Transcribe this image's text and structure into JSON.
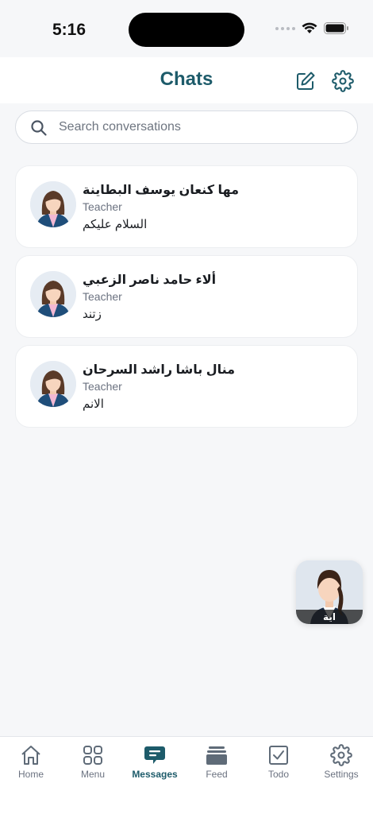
{
  "status": {
    "time": "5:16"
  },
  "header": {
    "title": "Chats",
    "compose_icon": "compose-icon",
    "settings_icon": "gear-icon"
  },
  "search": {
    "placeholder": "Search conversations",
    "value": ""
  },
  "chats": [
    {
      "name": "مها كنعان يوسف البطاينة",
      "role": "Teacher",
      "last_message": "السلام عليكم"
    },
    {
      "name": "ألاء حامد ناصر الزعبي",
      "role": "Teacher",
      "last_message": "زتند"
    },
    {
      "name": "منال باشا راشد السرحان",
      "role": "Teacher",
      "last_message": "الانم"
    }
  ],
  "floating_avatar": {
    "label": "اية"
  },
  "tabs": [
    {
      "label": "Home",
      "icon": "home-icon"
    },
    {
      "label": "Menu",
      "icon": "grid-icon"
    },
    {
      "label": "Messages",
      "icon": "chat-icon",
      "active": true
    },
    {
      "label": "Feed",
      "icon": "feed-icon"
    },
    {
      "label": "Todo",
      "icon": "checkbox-icon"
    },
    {
      "label": "Settings",
      "icon": "gear-icon"
    }
  ],
  "colors": {
    "accent": "#1d5b6a",
    "background": "#f6f7f9"
  }
}
